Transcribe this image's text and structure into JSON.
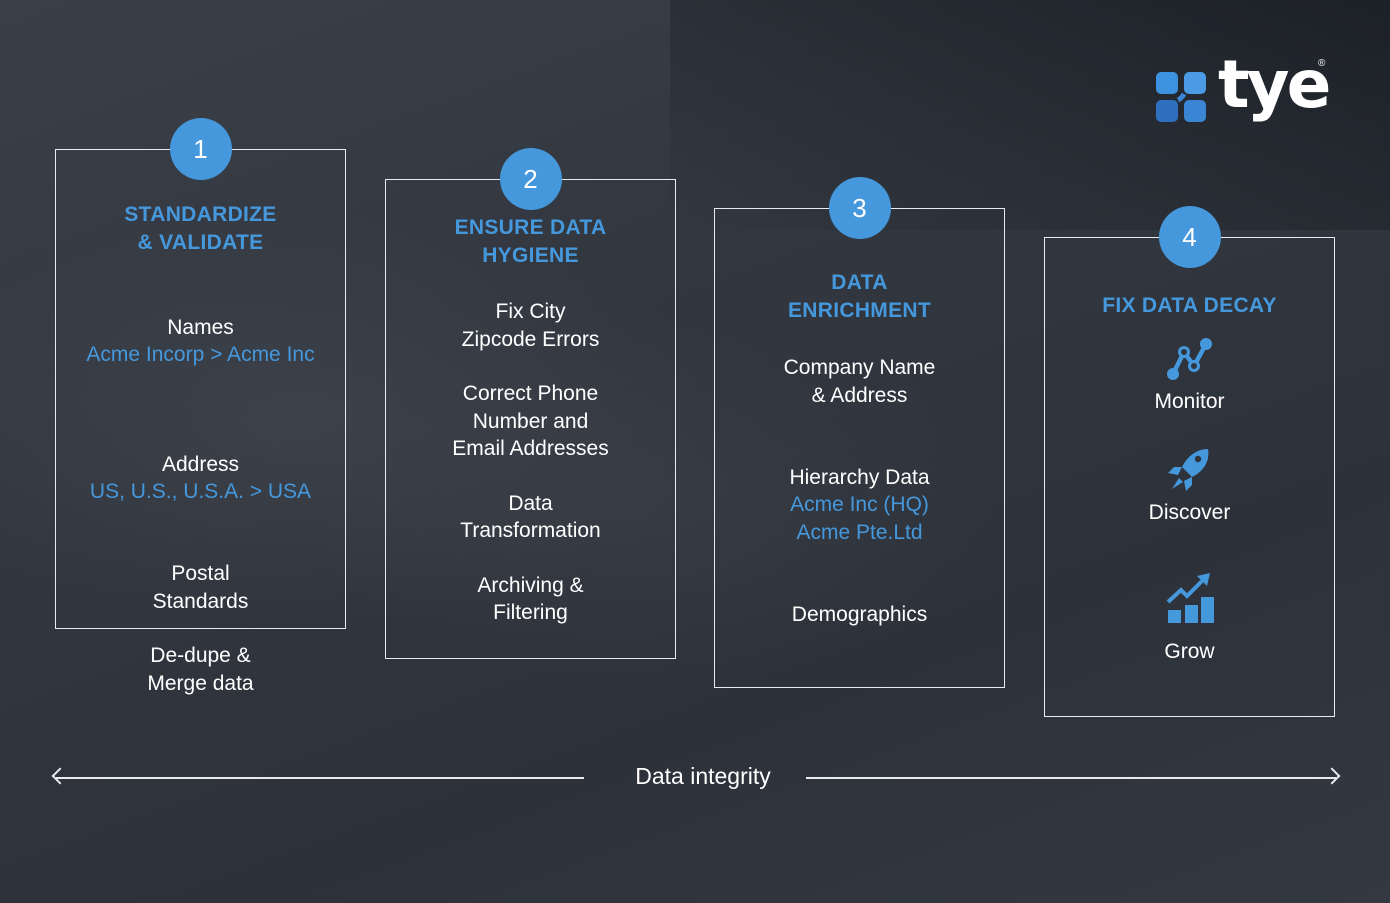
{
  "brand": {
    "name": "tye",
    "registered_mark": "®",
    "accent_color": "#4598dc"
  },
  "steps": [
    {
      "number": "1",
      "title": "STANDARDIZE\n& VALIDATE",
      "items": [
        {
          "label": "Names",
          "example": "Acme Incorp > Acme Inc"
        },
        {
          "label": "Address",
          "example": "US, U.S., U.S.A. > USA"
        },
        {
          "label": "Postal\nStandards"
        },
        {
          "label": "De-dupe &\nMerge data"
        }
      ]
    },
    {
      "number": "2",
      "title": "ENSURE  DATA\nHYGIENE",
      "items": [
        {
          "label": "Fix City\nZipcode Errors"
        },
        {
          "label": "Correct Phone\nNumber and\nEmail Addresses"
        },
        {
          "label": "Data\nTransformation"
        },
        {
          "label": "Archiving &\nFiltering"
        }
      ]
    },
    {
      "number": "3",
      "title": "DATA\nENRICHMENT",
      "items": [
        {
          "label": "Company Name\n& Address"
        },
        {
          "label": "Hierarchy Data",
          "example": "Acme Inc (HQ)\nAcme Pte.Ltd"
        },
        {
          "label": "Demographics"
        }
      ]
    },
    {
      "number": "4",
      "title": "FIX DATA DECAY",
      "items": [
        {
          "label": "Monitor",
          "icon": "monitor-line-chart-icon"
        },
        {
          "label": "Discover",
          "icon": "rocket-icon"
        },
        {
          "label": "Grow",
          "icon": "growth-bar-chart-icon"
        }
      ]
    }
  ],
  "axis": {
    "label": "Data integrity"
  }
}
